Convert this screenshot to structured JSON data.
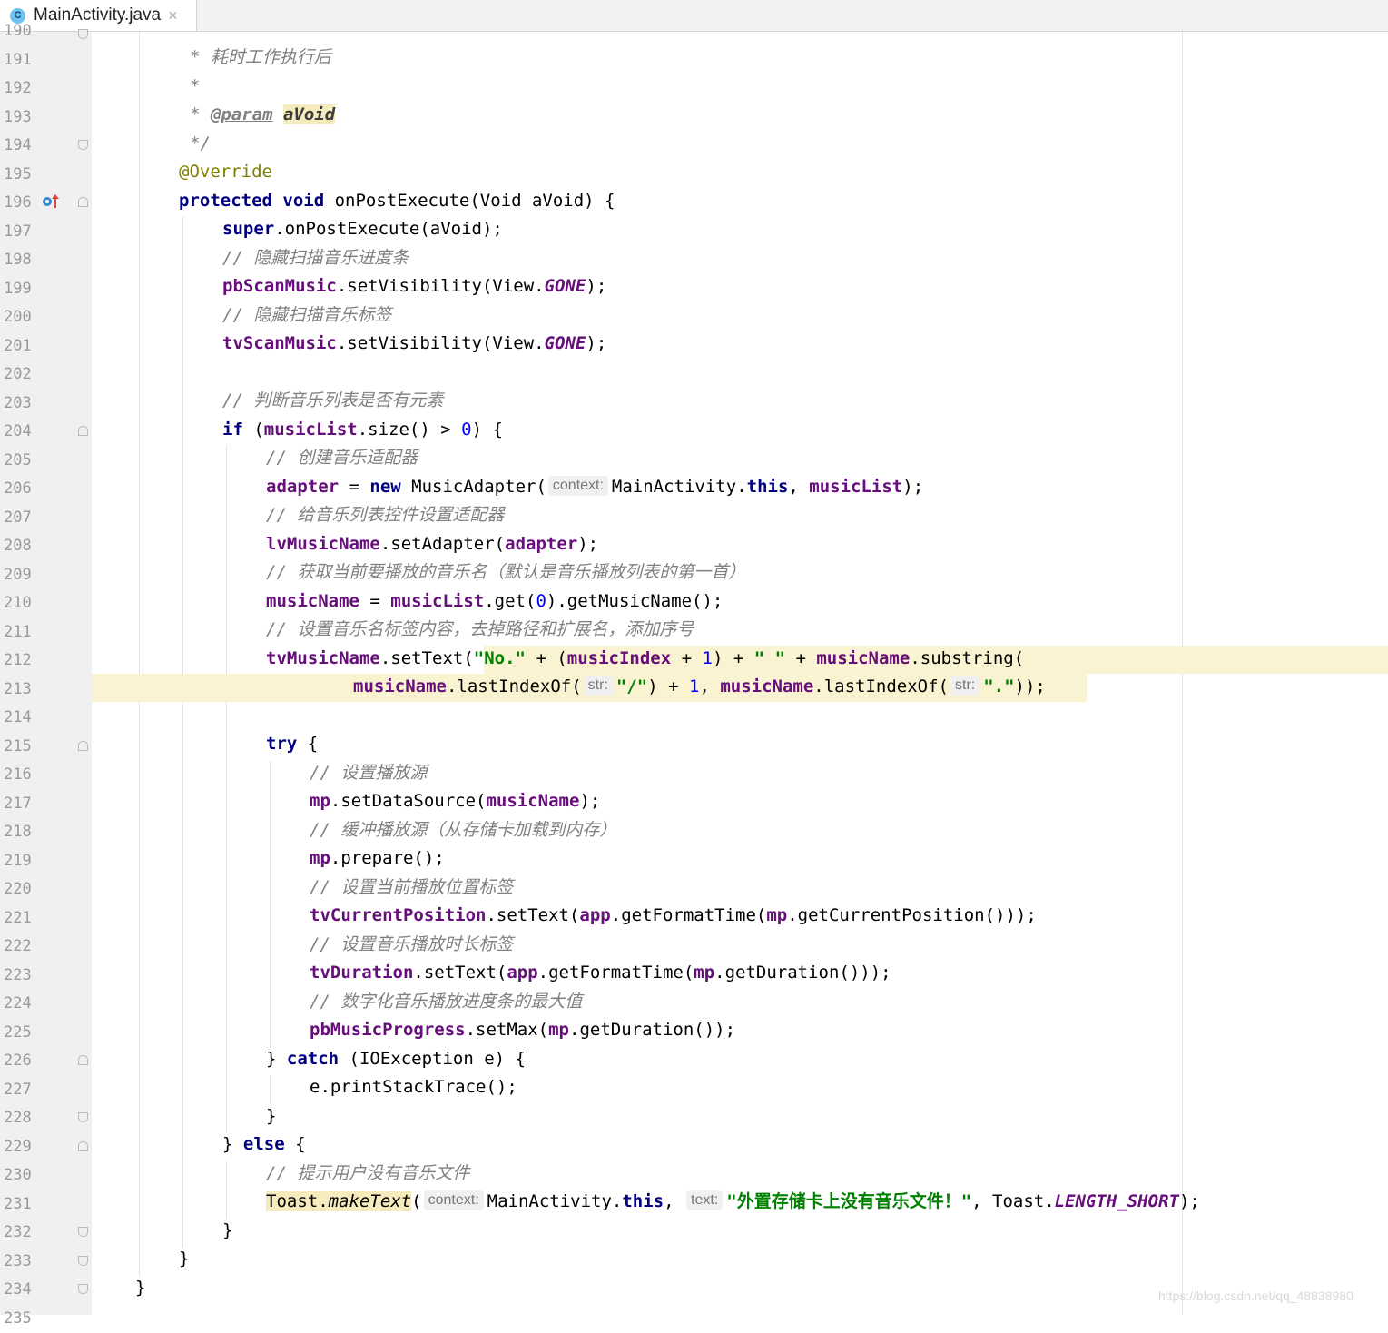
{
  "tab": {
    "icon_letter": "C",
    "file_name": "MainActivity.java",
    "close_glyph": "×"
  },
  "line_numbers": [
    "190",
    "191",
    "192",
    "193",
    "194",
    "195",
    "196",
    "197",
    "198",
    "199",
    "200",
    "201",
    "202",
    "203",
    "204",
    "205",
    "206",
    "207",
    "208",
    "209",
    "210",
    "211",
    "212",
    "213",
    "214",
    "215",
    "216",
    "217",
    "218",
    "219",
    "220",
    "221",
    "222",
    "223",
    "224",
    "225",
    "226",
    "227",
    "228",
    "229",
    "230",
    "231",
    "232",
    "233",
    "234",
    "235"
  ],
  "code": {
    "l191": "* 耗时工作执行后",
    "l192": "*",
    "l193_star": "* ",
    "l193_tag": "@param",
    "l193_param": "aVoid",
    "l194": "*/",
    "l195": "@Override",
    "l196_kw1": "protected",
    "l196_kw2": "void",
    "l196_rest": " onPostExecute(Void aVoid) {",
    "l197_kw": "super",
    "l197_rest": ".onPostExecute(aVoid);",
    "l198": "// 隐藏扫描音乐进度条",
    "l199_fld": "pbScanMusic",
    "l199_a": ".setVisibility(View.",
    "l199_const": "GONE",
    "l199_b": ");",
    "l200": "// 隐藏扫描音乐标签",
    "l201_fld": "tvScanMusic",
    "l201_a": ".setVisibility(View.",
    "l201_const": "GONE",
    "l201_b": ");",
    "l203": "// 判断音乐列表是否有元素",
    "l204_kw": "if",
    "l204_a": " (",
    "l204_fld": "musicList",
    "l204_b": ".size() > ",
    "l204_num": "0",
    "l204_c": ") {",
    "l205": "// 创建音乐适配器",
    "l206_fld": "adapter",
    "l206_a": " = ",
    "l206_kw": "new",
    "l206_b": " MusicAdapter(",
    "l206_hint": "context:",
    "l206_c": "MainActivity.",
    "l206_this": "this",
    "l206_d": ", ",
    "l206_fld2": "musicList",
    "l206_e": ");",
    "l207": "// 给音乐列表控件设置适配器",
    "l208_fld": "lvMusicName",
    "l208_a": ".setAdapter(",
    "l208_fld2": "adapter",
    "l208_b": ");",
    "l209": "// 获取当前要播放的音乐名（默认是音乐播放列表的第一首）",
    "l210_fld": "musicName",
    "l210_a": " = ",
    "l210_fld2": "musicList",
    "l210_b": ".get(",
    "l210_num": "0",
    "l210_c": ").getMusicName();",
    "l211": "// 设置音乐名标签内容，去掉路径和扩展名，添加序号",
    "l212_fld": "tvMusicName",
    "l212_a": ".setText(",
    "l212_str1": "\"No.\"",
    "l212_b": " + (",
    "l212_fld2": "musicIndex",
    "l212_c": " + ",
    "l212_num": "1",
    "l212_d": ") + ",
    "l212_str2": "\" \"",
    "l212_e": " + ",
    "l212_fld3": "musicName",
    "l212_f": ".substring(",
    "l213_fld": "musicName",
    "l213_a": ".lastIndexOf(",
    "l213_hint1": "str:",
    "l213_str1": "\"/\"",
    "l213_b": ") + ",
    "l213_num": "1",
    "l213_c": ", ",
    "l213_fld2": "musicName",
    "l213_d": ".lastIndexOf(",
    "l213_hint2": "str:",
    "l213_str2": "\".\"",
    "l213_e": "));",
    "l215_kw": "try",
    "l215_a": " {",
    "l216": "// 设置播放源",
    "l217_fld": "mp",
    "l217_a": ".setDataSource(",
    "l217_fld2": "musicName",
    "l217_b": ");",
    "l218": "// 缓冲播放源（从存储卡加载到内存）",
    "l219_fld": "mp",
    "l219_a": ".prepare();",
    "l220": "// 设置当前播放位置标签",
    "l221_fld": "tvCurrentPosition",
    "l221_a": ".setText(",
    "l221_fld2": "app",
    "l221_b": ".getFormatTime(",
    "l221_fld3": "mp",
    "l221_c": ".getCurrentPosition()));",
    "l222": "// 设置音乐播放时长标签",
    "l223_fld": "tvDuration",
    "l223_a": ".setText(",
    "l223_fld2": "app",
    "l223_b": ".getFormatTime(",
    "l223_fld3": "mp",
    "l223_c": ".getDuration()));",
    "l224": "// 数字化音乐播放进度条的最大值",
    "l225_fld": "pbMusicProgress",
    "l225_a": ".setMax(",
    "l225_fld2": "mp",
    "l225_b": ".getDuration());",
    "l226_a": "} ",
    "l226_kw": "catch",
    "l226_b": " (IOException e) {",
    "l227": "e.printStackTrace();",
    "l228": "}",
    "l229_a": "} ",
    "l229_kw": "else",
    "l229_b": " {",
    "l230": "// 提示用户没有音乐文件",
    "l231_cls": "Toast.",
    "l231_method": "makeText",
    "l231_a": "(",
    "l231_hint1": "context:",
    "l231_b": "MainActivity.",
    "l231_this": "this",
    "l231_c": ", ",
    "l231_hint2": "text:",
    "l231_str": "\"外置存储卡上没有音乐文件！\"",
    "l231_d": ", Toast.",
    "l231_const": "LENGTH_SHORT",
    "l231_e": ");",
    "l232": "}",
    "l233": "}",
    "l234": "}"
  },
  "watermark": "https://blog.csdn.net/qq_48838980"
}
